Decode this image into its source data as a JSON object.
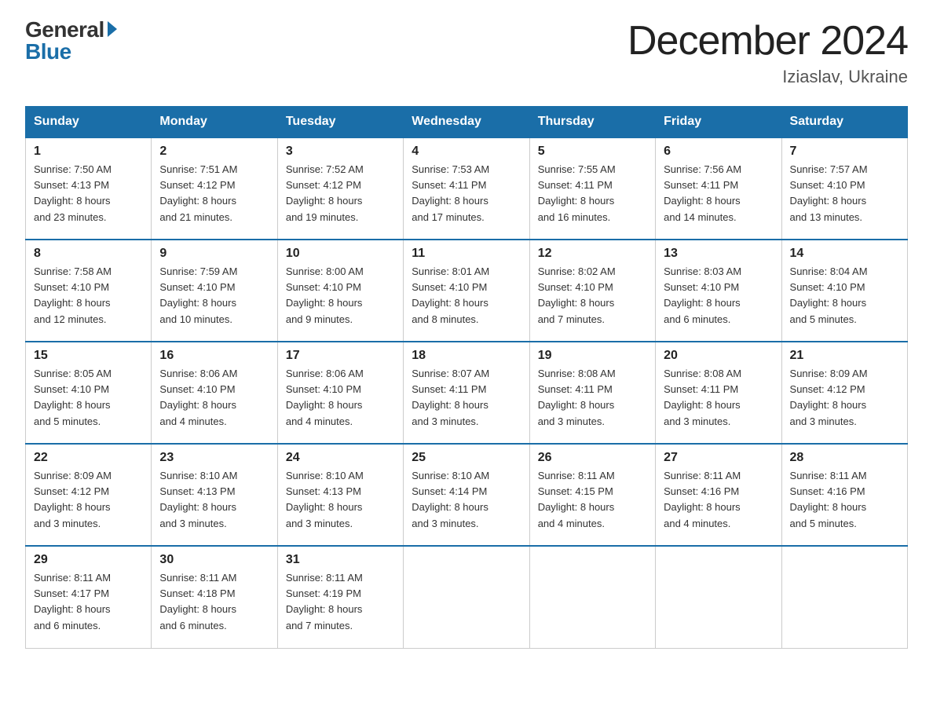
{
  "logo": {
    "general": "General",
    "blue": "Blue"
  },
  "header": {
    "month": "December 2024",
    "location": "Iziaslav, Ukraine"
  },
  "weekdays": [
    "Sunday",
    "Monday",
    "Tuesday",
    "Wednesday",
    "Thursday",
    "Friday",
    "Saturday"
  ],
  "weeks": [
    [
      {
        "day": "1",
        "sunrise": "7:50 AM",
        "sunset": "4:13 PM",
        "daylight": "8 hours and 23 minutes."
      },
      {
        "day": "2",
        "sunrise": "7:51 AM",
        "sunset": "4:12 PM",
        "daylight": "8 hours and 21 minutes."
      },
      {
        "day": "3",
        "sunrise": "7:52 AM",
        "sunset": "4:12 PM",
        "daylight": "8 hours and 19 minutes."
      },
      {
        "day": "4",
        "sunrise": "7:53 AM",
        "sunset": "4:11 PM",
        "daylight": "8 hours and 17 minutes."
      },
      {
        "day": "5",
        "sunrise": "7:55 AM",
        "sunset": "4:11 PM",
        "daylight": "8 hours and 16 minutes."
      },
      {
        "day": "6",
        "sunrise": "7:56 AM",
        "sunset": "4:11 PM",
        "daylight": "8 hours and 14 minutes."
      },
      {
        "day": "7",
        "sunrise": "7:57 AM",
        "sunset": "4:10 PM",
        "daylight": "8 hours and 13 minutes."
      }
    ],
    [
      {
        "day": "8",
        "sunrise": "7:58 AM",
        "sunset": "4:10 PM",
        "daylight": "8 hours and 12 minutes."
      },
      {
        "day": "9",
        "sunrise": "7:59 AM",
        "sunset": "4:10 PM",
        "daylight": "8 hours and 10 minutes."
      },
      {
        "day": "10",
        "sunrise": "8:00 AM",
        "sunset": "4:10 PM",
        "daylight": "8 hours and 9 minutes."
      },
      {
        "day": "11",
        "sunrise": "8:01 AM",
        "sunset": "4:10 PM",
        "daylight": "8 hours and 8 minutes."
      },
      {
        "day": "12",
        "sunrise": "8:02 AM",
        "sunset": "4:10 PM",
        "daylight": "8 hours and 7 minutes."
      },
      {
        "day": "13",
        "sunrise": "8:03 AM",
        "sunset": "4:10 PM",
        "daylight": "8 hours and 6 minutes."
      },
      {
        "day": "14",
        "sunrise": "8:04 AM",
        "sunset": "4:10 PM",
        "daylight": "8 hours and 5 minutes."
      }
    ],
    [
      {
        "day": "15",
        "sunrise": "8:05 AM",
        "sunset": "4:10 PM",
        "daylight": "8 hours and 5 minutes."
      },
      {
        "day": "16",
        "sunrise": "8:06 AM",
        "sunset": "4:10 PM",
        "daylight": "8 hours and 4 minutes."
      },
      {
        "day": "17",
        "sunrise": "8:06 AM",
        "sunset": "4:10 PM",
        "daylight": "8 hours and 4 minutes."
      },
      {
        "day": "18",
        "sunrise": "8:07 AM",
        "sunset": "4:11 PM",
        "daylight": "8 hours and 3 minutes."
      },
      {
        "day": "19",
        "sunrise": "8:08 AM",
        "sunset": "4:11 PM",
        "daylight": "8 hours and 3 minutes."
      },
      {
        "day": "20",
        "sunrise": "8:08 AM",
        "sunset": "4:11 PM",
        "daylight": "8 hours and 3 minutes."
      },
      {
        "day": "21",
        "sunrise": "8:09 AM",
        "sunset": "4:12 PM",
        "daylight": "8 hours and 3 minutes."
      }
    ],
    [
      {
        "day": "22",
        "sunrise": "8:09 AM",
        "sunset": "4:12 PM",
        "daylight": "8 hours and 3 minutes."
      },
      {
        "day": "23",
        "sunrise": "8:10 AM",
        "sunset": "4:13 PM",
        "daylight": "8 hours and 3 minutes."
      },
      {
        "day": "24",
        "sunrise": "8:10 AM",
        "sunset": "4:13 PM",
        "daylight": "8 hours and 3 minutes."
      },
      {
        "day": "25",
        "sunrise": "8:10 AM",
        "sunset": "4:14 PM",
        "daylight": "8 hours and 3 minutes."
      },
      {
        "day": "26",
        "sunrise": "8:11 AM",
        "sunset": "4:15 PM",
        "daylight": "8 hours and 4 minutes."
      },
      {
        "day": "27",
        "sunrise": "8:11 AM",
        "sunset": "4:16 PM",
        "daylight": "8 hours and 4 minutes."
      },
      {
        "day": "28",
        "sunrise": "8:11 AM",
        "sunset": "4:16 PM",
        "daylight": "8 hours and 5 minutes."
      }
    ],
    [
      {
        "day": "29",
        "sunrise": "8:11 AM",
        "sunset": "4:17 PM",
        "daylight": "8 hours and 6 minutes."
      },
      {
        "day": "30",
        "sunrise": "8:11 AM",
        "sunset": "4:18 PM",
        "daylight": "8 hours and 6 minutes."
      },
      {
        "day": "31",
        "sunrise": "8:11 AM",
        "sunset": "4:19 PM",
        "daylight": "8 hours and 7 minutes."
      },
      null,
      null,
      null,
      null
    ]
  ],
  "labels": {
    "sunrise": "Sunrise:",
    "sunset": "Sunset:",
    "daylight": "Daylight:"
  }
}
